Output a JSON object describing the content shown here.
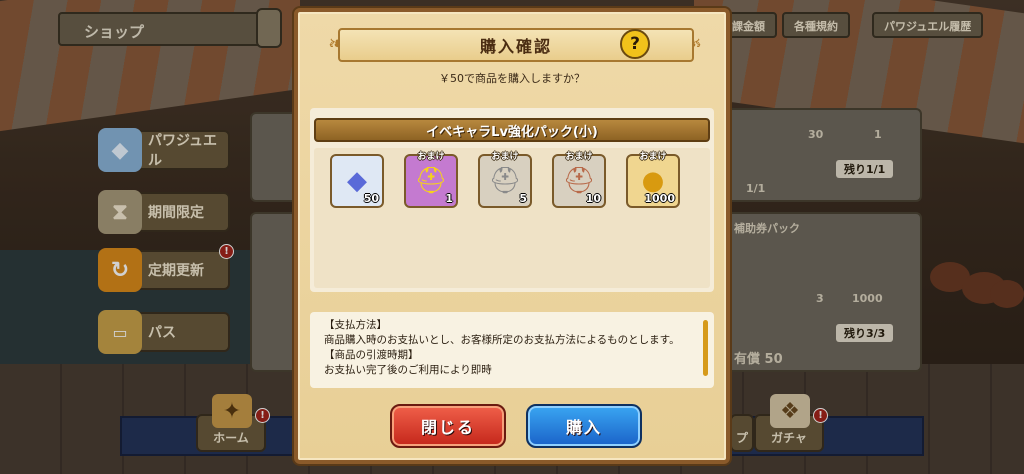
{
  "background": {
    "shop_title": "ショップ",
    "top_buttons": [
      "各種規約",
      "パワジュエル履歴"
    ],
    "top_partial": "課金額",
    "side_buttons": [
      {
        "label": "パワジュエル",
        "icon": "jewel-icon",
        "badge": ""
      },
      {
        "label": "期間限定",
        "icon": "hourglass-icon",
        "badge": ""
      },
      {
        "label": "定期更新",
        "icon": "refresh-icon",
        "badge": "!"
      },
      {
        "label": "パス",
        "icon": "ticket-icon",
        "badge": ""
      }
    ],
    "right_panel": {
      "remaining_1": "残り1/1",
      "count_1": "1/1",
      "pack_name_partial": "補助券パック",
      "ticket_qty": "3",
      "coin_qty": "1000",
      "remaining_2": "残り3/3",
      "price": "有償 50",
      "qty_top_a": "30",
      "qty_top_b": "1"
    },
    "nav": [
      {
        "label": "ホーム",
        "icon": "compass-icon",
        "badge": "!"
      },
      {
        "label": "ガチャ",
        "icon": "cards-icon",
        "badge": "!"
      }
    ],
    "nav_partial": "プ"
  },
  "modal": {
    "title": "購入確認",
    "help": "?",
    "question": "￥50で商品を購入しますか？",
    "pack_title": "イベキャラLv強化パック(小)",
    "items": [
      {
        "icon": "jewel-icon",
        "qty": "50",
        "omake": false,
        "label": ""
      },
      {
        "icon": "gold-helmet-icon",
        "qty": "1",
        "omake": true,
        "label": "おまけ"
      },
      {
        "icon": "silver-helmet-icon",
        "qty": "5",
        "omake": true,
        "label": "おまけ"
      },
      {
        "icon": "bronze-helmet-icon",
        "qty": "10",
        "omake": true,
        "label": "おまけ"
      },
      {
        "icon": "coin-icon",
        "qty": "1000",
        "omake": true,
        "label": "おまけ"
      }
    ],
    "terms": [
      "【支払方法】",
      "商品購入時のお支払いとし、お客様所定のお支払方法によるものとします。",
      "【商品の引渡時期】",
      "お支払い完了後のご利用により即時"
    ],
    "close_label": "閉じる",
    "buy_label": "購入"
  },
  "colors": {
    "close": "#d8382a",
    "buy": "#2a86e0",
    "modal_bg": "#ecd49e",
    "help": "#f1c21b"
  }
}
